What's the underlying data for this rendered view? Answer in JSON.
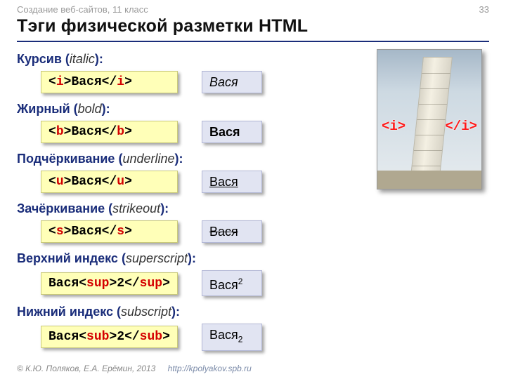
{
  "header": {
    "context": "Создание веб-сайтов, 11 класс",
    "page": "33"
  },
  "title": "Тэги физической разметки HTML",
  "rows": [
    {
      "label_ru": "Курсив",
      "label_en": "italic",
      "code_pre": "",
      "tag": "i",
      "code_inner": "Вася",
      "out_text": "Вася",
      "out_class": "italic"
    },
    {
      "label_ru": "Жирный",
      "label_en": "bold",
      "code_pre": "",
      "tag": "b",
      "code_inner": "Вася",
      "out_text": "Вася",
      "out_class": "bold"
    },
    {
      "label_ru": "Подчёркивание",
      "label_en": "underline",
      "code_pre": "",
      "tag": "u",
      "code_inner": "Вася",
      "out_text": "Вася",
      "out_class": "underline"
    },
    {
      "label_ru": "Зачёркивание",
      "label_en": "strikeout",
      "code_pre": "",
      "tag": "s",
      "code_inner": "Вася",
      "out_text": "Вася",
      "out_class": "strike"
    },
    {
      "label_ru": "Верхний индекс",
      "label_en": "superscript",
      "code_pre": "Вася",
      "tag": "sup",
      "code_inner": "2",
      "out_text": "Вася",
      "out_sup": "2"
    },
    {
      "label_ru": "Нижний индекс",
      "label_en": "subscript",
      "code_pre": "Вася",
      "tag": "sub",
      "code_inner": "2",
      "out_text": "Вася",
      "out_sub": "2"
    }
  ],
  "tower": {
    "open_tag": "<i>",
    "close_tag": "</i>"
  },
  "footer": {
    "copyright": "© К.Ю. Поляков, Е.А. Ерёмин, 2013",
    "url": "http://kpolyakov.spb.ru"
  }
}
